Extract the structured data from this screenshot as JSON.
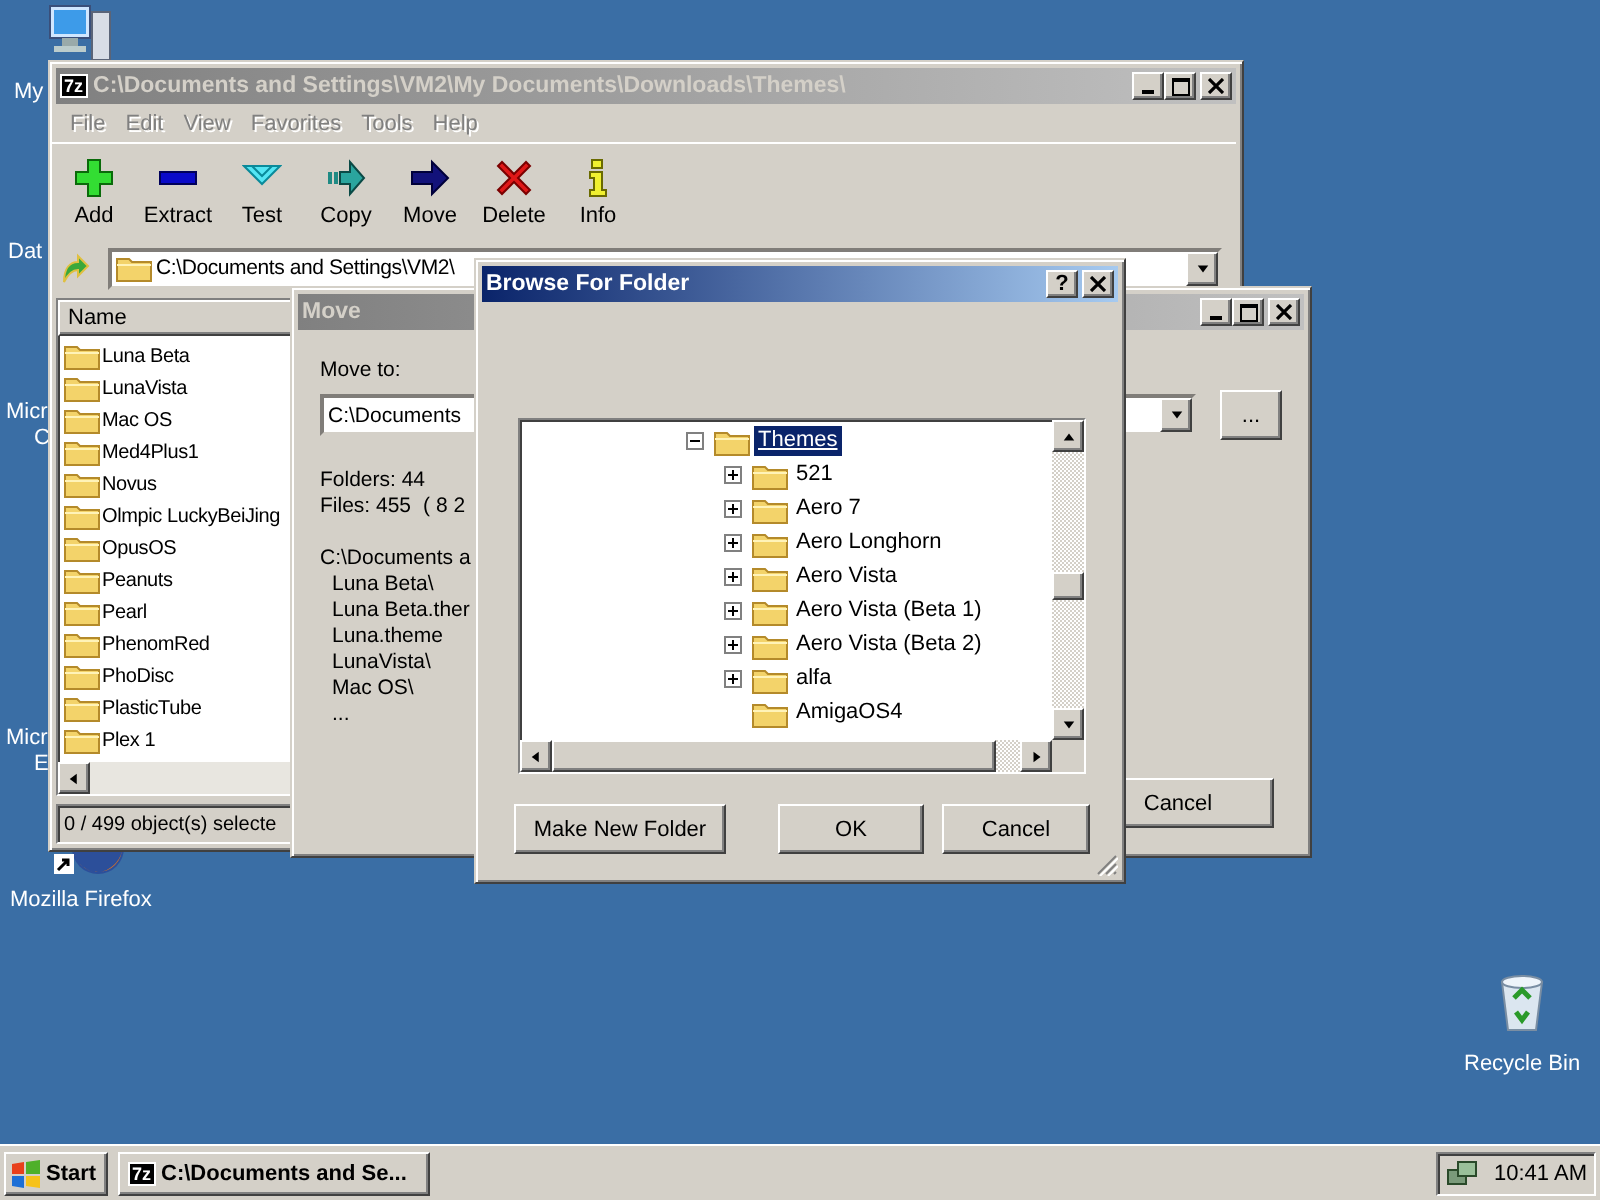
{
  "desktop_icons": [
    {
      "kind": "computer",
      "label": [
        "My"
      ]
    },
    {
      "kind": "hidden",
      "label": [
        "Dat"
      ]
    },
    {
      "kind": "hidden",
      "label": [
        "Micr",
        "C"
      ]
    },
    {
      "kind": "hidden",
      "label": [
        "Micr",
        "E"
      ]
    },
    {
      "kind": "firefox",
      "label": [
        "Mozilla Firefox"
      ]
    },
    {
      "kind": "recycle",
      "label": [
        "Recycle Bin"
      ]
    }
  ],
  "main_window": {
    "badge": "7z",
    "title": "C:\\Documents and Settings\\VM2\\My Documents\\Downloads\\Themes\\",
    "active": false,
    "menu": [
      {
        "label": "File",
        "disabled": true
      },
      {
        "label": "Edit",
        "disabled": true
      },
      {
        "label": "View",
        "disabled": true
      },
      {
        "label": "Favorites",
        "disabled": true
      },
      {
        "label": "Tools",
        "disabled": true
      },
      {
        "label": "Help",
        "disabled": true
      }
    ],
    "toolbar": [
      {
        "kind": "add",
        "label": "Add"
      },
      {
        "kind": "extract",
        "label": "Extract"
      },
      {
        "kind": "test",
        "label": "Test"
      },
      {
        "kind": "copy",
        "label": "Copy"
      },
      {
        "kind": "move",
        "label": "Move"
      },
      {
        "kind": "delete",
        "label": "Delete"
      },
      {
        "kind": "info",
        "label": "Info"
      }
    ],
    "address": "C:\\Documents and Settings\\VM2\\",
    "columns": [
      "Name"
    ],
    "files": [
      "Luna Beta",
      "LunaVista",
      "Mac OS",
      "Med4Plus1",
      "Novus",
      "Olmpic LuckyBeiJing",
      "OpusOS",
      "Peanuts",
      "Pearl",
      "PhenomRed",
      "PhoDisc",
      "PlasticTube",
      "Plex 1"
    ],
    "status": "0 / 499 object(s) selecte"
  },
  "move_dialog": {
    "title": "Move",
    "active": false,
    "move_to_label": "Move to:",
    "path": "C:\\Documents",
    "browse_button": "...",
    "folders": "Folders: 44",
    "files": "Files: 455",
    "size": "( 8 2",
    "source_path": "C:\\Documents a",
    "items": [
      "Luna Beta\\",
      "Luna Beta.ther",
      "Luna.theme",
      "LunaVista\\",
      "Mac OS\\",
      "..."
    ],
    "cancel": "Cancel"
  },
  "browse_dialog": {
    "title": "Browse For Folder",
    "active": true,
    "help_button": "?",
    "tree": [
      {
        "label": "Themes",
        "has_children": true,
        "expanded": true,
        "selected": true,
        "children": [
          {
            "label": "521",
            "has_children": true,
            "selected": false
          },
          {
            "label": "Aero 7",
            "has_children": true,
            "selected": false
          },
          {
            "label": "Aero Longhorn",
            "has_children": true,
            "selected": false
          },
          {
            "label": "Aero Vista",
            "has_children": true,
            "selected": false
          },
          {
            "label": "Aero Vista (Beta 1)",
            "has_children": true,
            "selected": false
          },
          {
            "label": "Aero Vista (Beta 2)",
            "has_children": true,
            "selected": false
          },
          {
            "label": "alfa",
            "has_children": true,
            "selected": false
          },
          {
            "label": "AmigaOS4",
            "has_children": false,
            "selected": false
          }
        ]
      }
    ],
    "buttons": [
      {
        "kind": "new",
        "label": "Make New Folder"
      },
      {
        "kind": "ok",
        "label": "OK"
      },
      {
        "kind": "cancel",
        "label": "Cancel"
      }
    ]
  },
  "taskbar": {
    "start": "Start",
    "tasks": [
      {
        "badge": "7z",
        "label": "C:\\Documents and Se...",
        "selected": false
      }
    ],
    "clock": "10:41 AM"
  }
}
